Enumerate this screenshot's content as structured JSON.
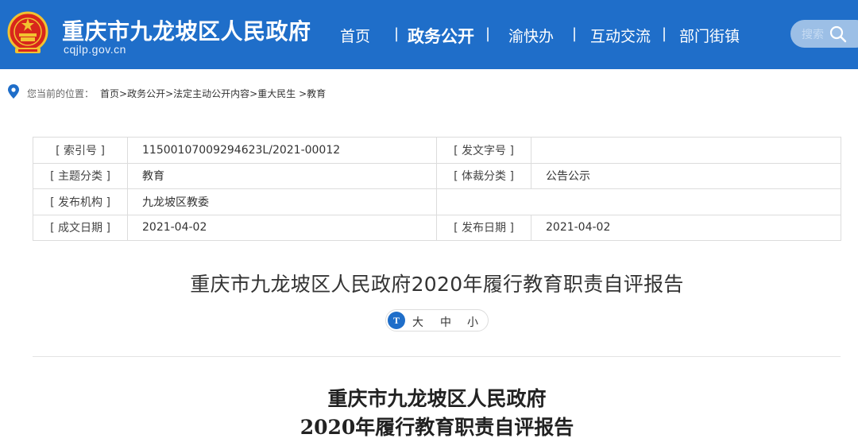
{
  "header": {
    "site_title": "重庆市九龙坡区人民政府",
    "site_domain": "cqjlp.gov.cn",
    "brand_color": "#1f6ec9",
    "nav": [
      {
        "label": "首页"
      },
      {
        "label": "政务公开",
        "active": true
      },
      {
        "label": "渝快办"
      },
      {
        "label": "互动交流"
      },
      {
        "label": "部门街镇"
      }
    ],
    "nav_separator": "|",
    "search": {
      "placeholder": "搜索",
      "icon": "search-icon"
    }
  },
  "breadcrumb": {
    "icon": "location-pin-icon",
    "lead": "您当前的位置：",
    "items": [
      "首页",
      "政务公开",
      "法定主动公开内容",
      "重大民生",
      "教育"
    ],
    "separator": ">"
  },
  "meta": {
    "index_no_label": "[ 索引号 ]",
    "index_no_value": "11500107009294623L/2021-00012",
    "doc_no_label": "[ 发文字号 ]",
    "doc_no_value": "",
    "topic_label": "[ 主题分类 ]",
    "topic_value": "教育",
    "genre_label": "[ 体裁分类 ]",
    "genre_value": "公告公示",
    "publisher_label": "[ 发布机构 ]",
    "publisher_value": "九龙坡区教委",
    "created_label": "[ 成文日期 ]",
    "created_value": "2021-04-02",
    "published_label": "[ 发布日期 ]",
    "published_value": "2021-04-02"
  },
  "article": {
    "title": "重庆市九龙坡区人民政府2020年履行教育职责自评报告",
    "font_size": {
      "icon": "font-size-icon",
      "icon_glyph": "T",
      "large": "大",
      "medium": "中",
      "small": "小"
    },
    "body_heading_line1": "重庆市九龙坡区人民政府",
    "body_heading_line2": "2020年履行教育职责自评报告"
  }
}
